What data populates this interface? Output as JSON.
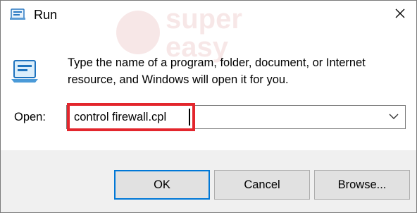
{
  "window": {
    "title": "Run",
    "app_icon": "run-icon",
    "close_icon": "close-icon"
  },
  "watermark": {
    "line1": "super",
    "line2": "easy"
  },
  "content": {
    "icon": "run-program-icon",
    "description": "Type the name of a program, folder, document, or Internet resource, and Windows will open it for you."
  },
  "open": {
    "label": "Open:",
    "value": "control firewall.cpl",
    "dropdown_icon": "chevron-down-icon"
  },
  "buttons": {
    "ok": "OK",
    "cancel": "Cancel",
    "browse": "Browse..."
  },
  "colors": {
    "highlight": "#e3262d",
    "focus_border": "#0078d7",
    "footer_bg": "#f0f0f0"
  }
}
